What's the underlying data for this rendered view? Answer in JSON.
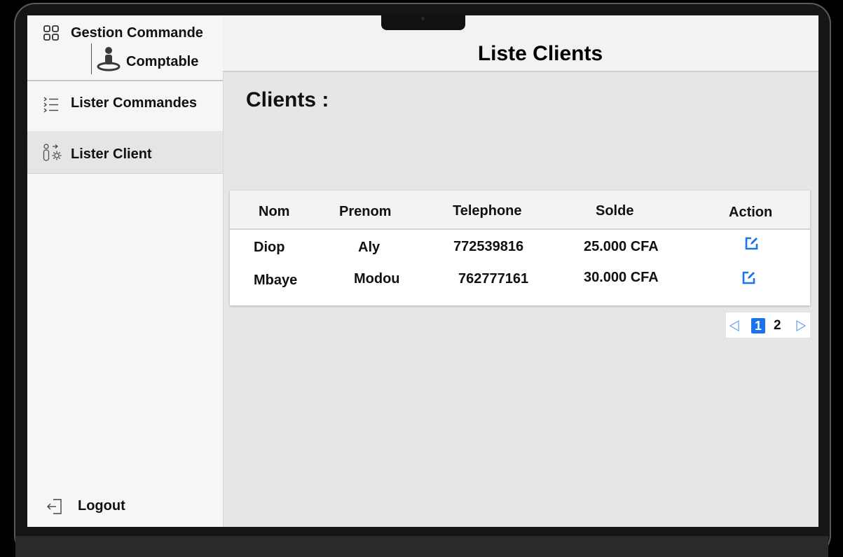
{
  "sidebar": {
    "brand_title": "Gestion Commande",
    "brand_icon": "grid-icon",
    "role_label": "Comptable",
    "role_icon": "user-icon",
    "items": [
      {
        "label": "Lister Commandes",
        "icon": "list-icon",
        "active": false
      },
      {
        "label": "Lister Client",
        "icon": "user-settings-icon",
        "active": true
      }
    ],
    "logout_label": "Logout",
    "logout_icon": "logout-icon"
  },
  "header": {
    "title": "Liste Clients"
  },
  "main": {
    "section_title": "Clients :",
    "table": {
      "columns": [
        "Nom",
        "Prenom",
        "Telephone",
        "Solde",
        "Action"
      ],
      "rows": [
        {
          "nom": "Diop",
          "prenom": "Aly",
          "telephone": "772539816",
          "solde": "25.000 CFA",
          "action_icon": "edit-icon"
        },
        {
          "nom": "Mbaye",
          "prenom": "Modou",
          "telephone": "762777161",
          "solde": "30.000 CFA",
          "action_icon": "edit-icon"
        }
      ]
    },
    "pagination": {
      "current": "1",
      "pages": [
        "1",
        "2"
      ],
      "prev_icon": "chevron-left-icon",
      "next_icon": "chevron-right-icon"
    }
  },
  "colors": {
    "accent": "#1a73e8",
    "sidebar_bg": "#f6f6f6",
    "content_bg": "#e6e6e6"
  }
}
